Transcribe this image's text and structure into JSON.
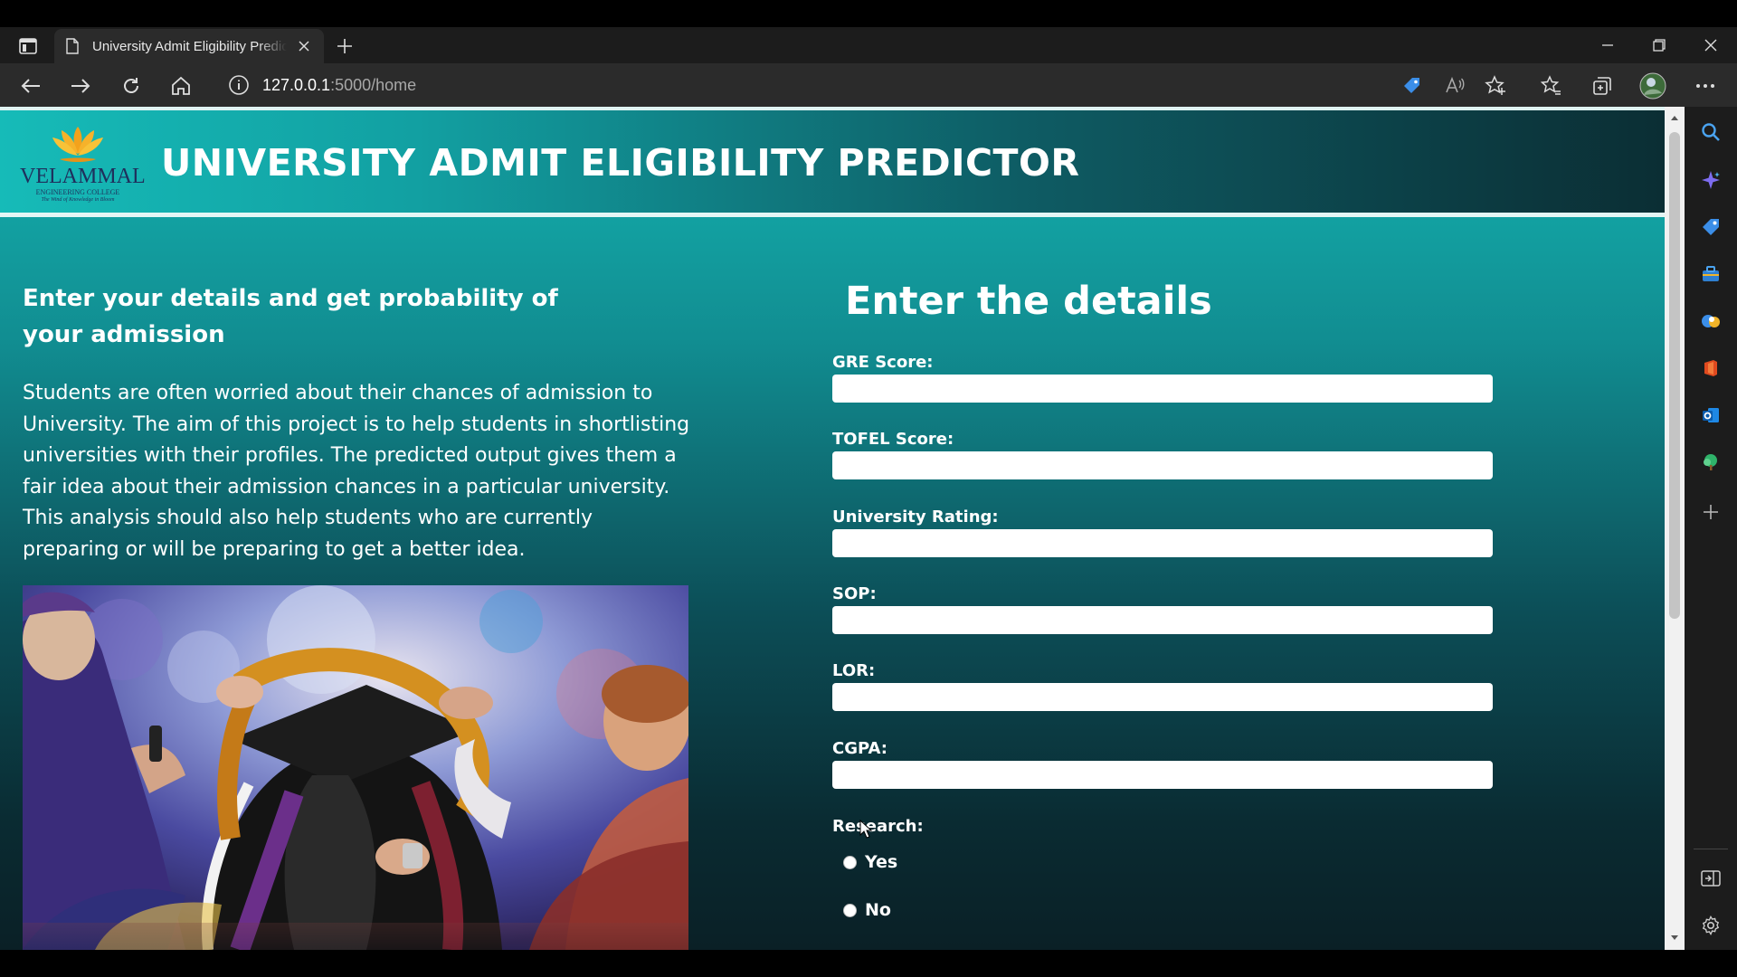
{
  "browser": {
    "tab_title": "University Admit Eligibility Predictor",
    "url_host": "127.0.0.1",
    "url_path": ":5000/home"
  },
  "header": {
    "logo_name": "VELAMMAL",
    "logo_sub": "ENGINEERING COLLEGE",
    "logo_tagline": "The Wind of Knowledge in Bloom",
    "title": "UNIVERSITY ADMIT ELIGIBILITY PREDICTOR"
  },
  "intro": {
    "heading": "Enter your details and get probability of your admission",
    "paragraph": "Students are often worried about their chances of admission to University. The aim of this project is to help students in shortlisting universities with their profiles. The predicted output gives them a fair idea about their admission chances in a particular university. This analysis should also help students who are currently preparing or will be preparing to get a better idea."
  },
  "form": {
    "heading": "Enter the details",
    "fields": [
      {
        "label": "GRE Score:",
        "value": ""
      },
      {
        "label": "TOFEL Score:",
        "value": ""
      },
      {
        "label": "University Rating:",
        "value": ""
      },
      {
        "label": "SOP:",
        "value": ""
      },
      {
        "label": "LOR:",
        "value": ""
      },
      {
        "label": "CGPA:",
        "value": ""
      }
    ],
    "research_label": "Research:",
    "research_options": [
      "Yes",
      "No"
    ]
  },
  "colors": {
    "accent_teal": "#14b2b0",
    "dark_teal": "#0a2b32",
    "chrome_dark": "#2b2b2b"
  }
}
